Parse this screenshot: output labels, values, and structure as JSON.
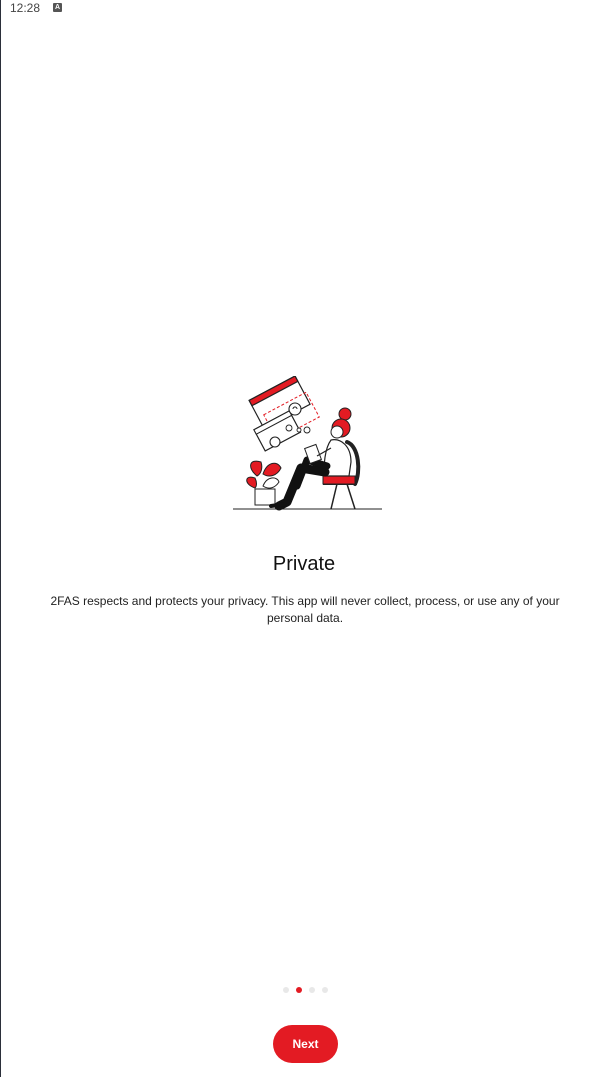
{
  "status_bar": {
    "time": "12:28",
    "notification_icon": "A"
  },
  "illustration": {
    "icon": "privacy-person-illustration",
    "accent_color": "#e31b23"
  },
  "onboarding": {
    "title": "Private",
    "description": "2FAS respects and protects your privacy. This app will never collect, process, or use any of your personal data.",
    "page_count": 4,
    "current_page": 2,
    "next_label": "Next"
  },
  "colors": {
    "accent": "#e31b23",
    "inactive_dot": "#e8e8e8"
  }
}
